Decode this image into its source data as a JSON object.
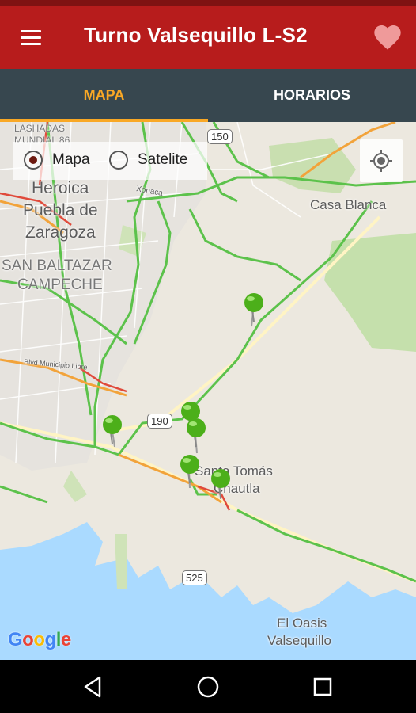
{
  "app_bar": {
    "title": "Turno Valsequillo L-S2",
    "menu_icon": "hamburger-menu-icon",
    "favorite_icon": "heart-icon"
  },
  "tabs": [
    {
      "label": "MAPA",
      "selected": true
    },
    {
      "label": "HORARIOS",
      "selected": false
    }
  ],
  "map": {
    "view_options": [
      {
        "label": "Mapa",
        "selected": true
      },
      {
        "label": "Satelite",
        "selected": false
      }
    ],
    "locate_icon": "my-location-icon",
    "labels": {
      "lashadas": "LASHADAS",
      "mundial": "MUNDIAL 86",
      "heroica": "Heroica",
      "puebla": "Puebla de",
      "zaragoza": "Zaragoza",
      "san_baltazar": "SAN BALTAZAR",
      "campeche": "CAMPECHE",
      "xonaca": "Xonaca",
      "casa_blanca": "Casa Blanca",
      "santa_tomas": "Santa Tomás",
      "chautla": "Chautla",
      "el_oasis": "El Oasis",
      "valsequillo": "Valsequillo",
      "blvd": "Blvd Municipio Libre"
    },
    "shields": {
      "route_150": "150",
      "route_190": "190",
      "route_525": "525"
    },
    "google_logo": {
      "letters": [
        "G",
        "o",
        "o",
        "g",
        "l",
        "e"
      ],
      "colors": [
        "#4285F4",
        "#EA4335",
        "#FBBC05",
        "#4285F4",
        "#34A853",
        "#EA4335"
      ]
    },
    "pin_color": "#4caf1a",
    "pin_count": 6
  },
  "colors": {
    "app_bar": "#b71c1c",
    "tab_bar": "#37474f",
    "tab_selected": "#f9a825"
  },
  "nav_bar": {
    "back_icon": "back-triangle-icon",
    "home_icon": "home-circle-icon",
    "recents_icon": "recents-square-icon"
  }
}
